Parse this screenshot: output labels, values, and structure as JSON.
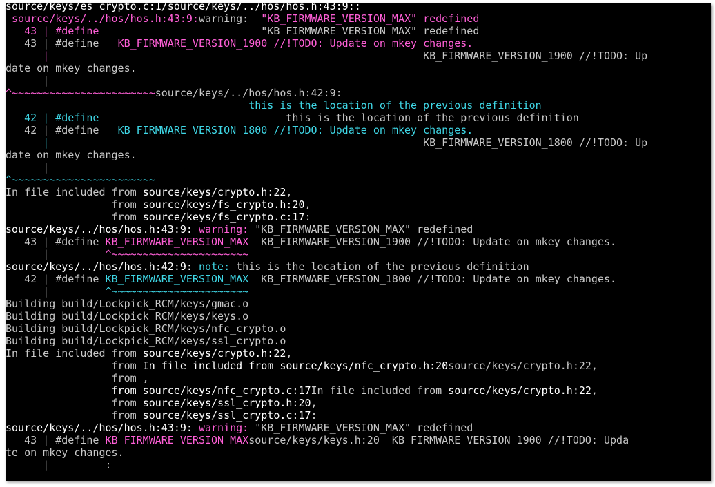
{
  "colors": {
    "background": "#000000",
    "text": "#d0d0d0",
    "path_text": "#ffffff",
    "warning": "#ff5fd7",
    "note": "#3fd7e6"
  },
  "terminal": {
    "lines": [
      [
        {
          "t": "source/keys/es_crypto.c:1/source/keys/../hos/hos.h:43:9::",
          "c": "white"
        }
      ],
      [
        {
          "t": " source/keys/../hos/hos.h:43:9:",
          "c": "magenta"
        },
        {
          "t": "warning:  ",
          "c": "gray"
        },
        {
          "t": "\"KB_FIRMWARE_VERSION_MAX\" redefined",
          "c": "magenta"
        }
      ],
      [
        {
          "t": "   43 | #define",
          "c": "magenta"
        },
        {
          "t": "                          \"KB_FIRMWARE_VERSION_MAX\" redefined",
          "c": "gray"
        }
      ],
      [
        {
          "t": "   43 | #define   ",
          "c": "gray"
        },
        {
          "t": "KB_FIRMWARE_VERSION_1900 //!TODO: Update on mkey changes.",
          "c": "magenta"
        }
      ],
      [
        {
          "t": "      |",
          "c": "magenta"
        },
        {
          "t": "                                                            KB_FIRMWARE_VERSION_1900 //!TODO: Up",
          "c": "gray"
        }
      ],
      [
        {
          "t": "date on mkey changes.",
          "c": "gray"
        }
      ],
      [
        {
          "t": "      |",
          "c": "gray"
        }
      ],
      [
        {
          "t": "^~~~~~~~~~~~~~~~~~~~~~~~",
          "c": "magenta"
        },
        {
          "t": "source/keys/../hos/hos.h:42:9:",
          "c": "gray"
        }
      ],
      [
        {
          "t": "                                       this is the location of the previous definition",
          "c": "cyan"
        }
      ],
      [
        {
          "t": "   42 | #define",
          "c": "cyan"
        },
        {
          "t": "                              this is the location of the previous definition",
          "c": "gray"
        }
      ],
      [
        {
          "t": "   42 | #define   ",
          "c": "gray"
        },
        {
          "t": "KB_FIRMWARE_VERSION_1800 //!TODO: Update on mkey changes.",
          "c": "cyan"
        }
      ],
      [
        {
          "t": "      |",
          "c": "cyan"
        },
        {
          "t": "                                                            KB_FIRMWARE_VERSION_1800 //!TODO: Up",
          "c": "gray"
        }
      ],
      [
        {
          "t": "date on mkey changes.",
          "c": "gray"
        }
      ],
      [
        {
          "t": "      |",
          "c": "gray"
        }
      ],
      [
        {
          "t": "^~~~~~~~~~~~~~~~~~~~~~~~",
          "c": "cyan"
        }
      ],
      [
        {
          "t": "In file included from ",
          "c": "gray"
        },
        {
          "t": "source/keys/crypto.h:22",
          "c": "white"
        },
        {
          "t": ",",
          "c": "gray"
        }
      ],
      [
        {
          "t": "                 from ",
          "c": "gray"
        },
        {
          "t": "source/keys/fs_crypto.h:20",
          "c": "white"
        },
        {
          "t": ",",
          "c": "gray"
        }
      ],
      [
        {
          "t": "                 from ",
          "c": "gray"
        },
        {
          "t": "source/keys/fs_crypto.c:17",
          "c": "white"
        },
        {
          "t": ":",
          "c": "gray"
        }
      ],
      [
        {
          "t": "source/keys/../hos/hos.h:43:9: ",
          "c": "white"
        },
        {
          "t": "warning: ",
          "c": "magenta"
        },
        {
          "t": "\"KB_FIRMWARE_VERSION_MAX\" redefined",
          "c": "gray"
        }
      ],
      [
        {
          "t": "   43 | #define ",
          "c": "gray"
        },
        {
          "t": "KB_FIRMWARE_VERSION_MAX",
          "c": "magenta"
        },
        {
          "t": "  KB_FIRMWARE_VERSION_1900 //!TODO: Update on mkey changes.",
          "c": "gray"
        }
      ],
      [
        {
          "t": "      |         ",
          "c": "gray"
        },
        {
          "t": "^~~~~~~~~~~~~~~~~~~~~~~",
          "c": "magenta"
        }
      ],
      [
        {
          "t": "source/keys/../hos/hos.h:42:9: ",
          "c": "white"
        },
        {
          "t": "note: ",
          "c": "cyan"
        },
        {
          "t": "this is the location of the previous definition",
          "c": "gray"
        }
      ],
      [
        {
          "t": "   42 | #define ",
          "c": "gray"
        },
        {
          "t": "KB_FIRMWARE_VERSION_MAX",
          "c": "cyan"
        },
        {
          "t": "  KB_FIRMWARE_VERSION_1800 //!TODO: Update on mkey changes.",
          "c": "gray"
        }
      ],
      [
        {
          "t": "      |         ",
          "c": "gray"
        },
        {
          "t": "^~~~~~~~~~~~~~~~~~~~~~~",
          "c": "cyan"
        }
      ],
      [
        {
          "t": "Building build/Lockpick_RCM/keys/gmac.o",
          "c": "gray"
        }
      ],
      [
        {
          "t": "Building build/Lockpick_RCM/keys/keys.o",
          "c": "gray"
        }
      ],
      [
        {
          "t": "Building build/Lockpick_RCM/keys/nfc_crypto.o",
          "c": "gray"
        }
      ],
      [
        {
          "t": "Building build/Lockpick_RCM/keys/ssl_crypto.o",
          "c": "gray"
        }
      ],
      [
        {
          "t": "In file included from ",
          "c": "gray"
        },
        {
          "t": "source/keys/crypto.h:22",
          "c": "white"
        },
        {
          "t": ",",
          "c": "gray"
        }
      ],
      [
        {
          "t": "                 from ",
          "c": "gray"
        },
        {
          "t": "In file included from source/keys/nfc_crypto.h:20",
          "c": "white"
        },
        {
          "t": "source/keys/crypto.h:22,",
          "c": "gray"
        }
      ],
      [
        {
          "t": "                 from ,",
          "c": "gray"
        }
      ],
      [
        {
          "t": "                 from source/keys/nfc_crypto.c:17",
          "c": "white"
        },
        {
          "t": "In file included from ",
          "c": "gray"
        },
        {
          "t": "source/keys/crypto.h:22",
          "c": "white"
        },
        {
          "t": ",",
          "c": "gray"
        }
      ],
      [
        {
          "t": "                 from ",
          "c": "gray"
        },
        {
          "t": "source/keys/ssl_crypto.h:20",
          "c": "white"
        },
        {
          "t": ",",
          "c": "gray"
        }
      ],
      [
        {
          "t": "                 from ",
          "c": "gray"
        },
        {
          "t": "source/keys/ssl_crypto.c:17",
          "c": "white"
        },
        {
          "t": ":",
          "c": "gray"
        }
      ],
      [
        {
          "t": "source/keys/../hos/hos.h:43:9: ",
          "c": "white"
        },
        {
          "t": "warning: ",
          "c": "magenta"
        },
        {
          "t": "\"KB_FIRMWARE_VERSION_MAX\" redefined",
          "c": "gray"
        }
      ],
      [
        {
          "t": "   43 | #define ",
          "c": "gray"
        },
        {
          "t": "KB_FIRMWARE_VERSION_MAX",
          "c": "magenta"
        },
        {
          "t": "source/keys/keys.h:20  KB_FIRMWARE_VERSION_1900 //!TODO: Upda",
          "c": "gray"
        }
      ],
      [
        {
          "t": "te on mkey changes.",
          "c": "gray"
        }
      ],
      [
        {
          "t": "      |         :",
          "c": "gray"
        }
      ]
    ]
  }
}
